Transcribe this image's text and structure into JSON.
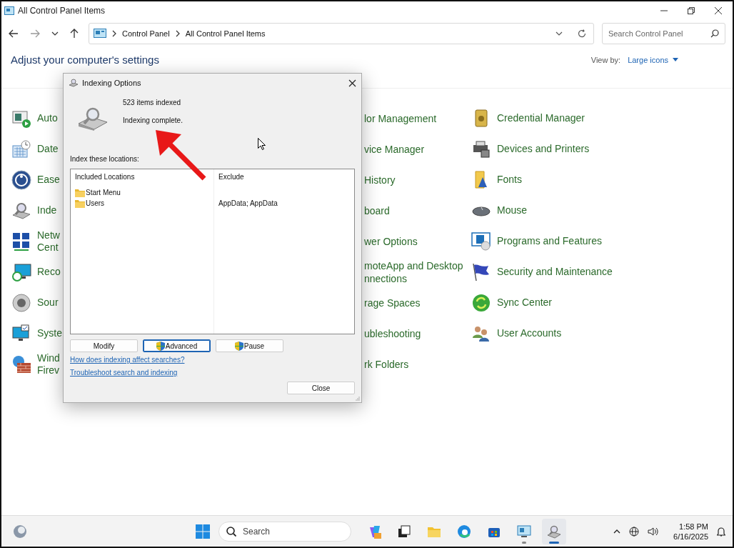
{
  "window": {
    "title": "All Control Panel Items"
  },
  "address_bar": {
    "breadcrumbs": [
      "Control Panel",
      "All Control Panel Items"
    ]
  },
  "search": {
    "placeholder": "Search Control Panel"
  },
  "header": {
    "title": "Adjust your computer's settings",
    "view_by_label": "View by:",
    "view_by_value": "Large icons"
  },
  "columns": [
    [
      "Auto",
      "Date",
      "Ease",
      "Inde",
      "Netw\nCent",
      "Reco",
      "Sour",
      "Syste",
      "Wind\nFirev"
    ],
    [
      "lor Management",
      "vice Manager",
      "History",
      "board",
      "wer Options",
      "moteApp and Desktop\nnnections",
      "rage Spaces",
      "ubleshooting",
      "rk Folders"
    ],
    [
      "Credential Manager",
      "Devices and Printers",
      "Fonts",
      "Mouse",
      "Programs and Features",
      "Security and Maintenance",
      "Sync Center",
      "User Accounts"
    ]
  ],
  "dialog": {
    "title": "Indexing Options",
    "items_indexed": "523 items indexed",
    "status": "Indexing complete.",
    "locations_label": "Index these locations:",
    "list_columns": [
      "Included Locations",
      "Exclude"
    ],
    "rows": [
      {
        "location": "Start Menu"
      },
      {
        "location": "Users",
        "exclude": "AppData; AppData"
      }
    ],
    "buttons": [
      {
        "label": "Modify",
        "shield": false,
        "focused": false
      },
      {
        "label": "Advanced",
        "shield": true,
        "focused": true
      },
      {
        "label": "Pause",
        "shield": true,
        "focused": false
      }
    ],
    "links": [
      "How does indexing affect searches?",
      "Troubleshoot search and indexing"
    ],
    "close_button": "Close"
  },
  "taskbar": {
    "search_placeholder": "Search",
    "apps": [
      {
        "running": false,
        "active": false
      },
      {
        "running": false,
        "active": false
      },
      {
        "running": false,
        "active": false
      },
      {
        "running": false,
        "active": false
      },
      {
        "running": false,
        "active": false
      },
      {
        "running": true,
        "active": false
      },
      {
        "running": true,
        "active": true
      }
    ],
    "clock": {
      "time": "1:58 PM",
      "date": "6/16/2025"
    }
  }
}
